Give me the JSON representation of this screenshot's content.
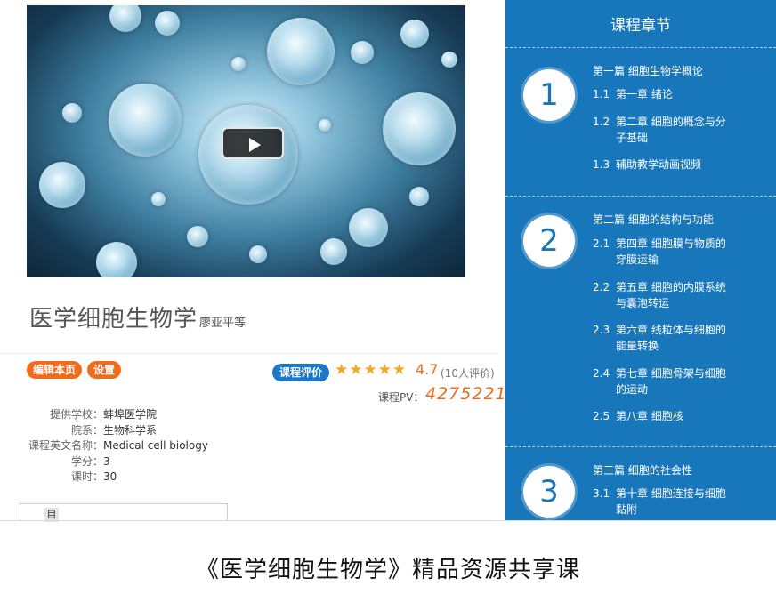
{
  "course": {
    "title": "医学细胞生物学",
    "author": "廖亚平等"
  },
  "actions": {
    "edit_label": "编辑本页",
    "settings_label": "设置",
    "rating_label": "课程评价"
  },
  "rating": {
    "stars": "★★★★★",
    "score": "4.7",
    "count_text": "(10人评价)",
    "value": 4.7,
    "max": 5
  },
  "pv": {
    "label": "课程PV：",
    "value": "4275221"
  },
  "meta": [
    {
      "key": "提供学校：",
      "value": "蚌埠医学院"
    },
    {
      "key": "院系：",
      "value": "生物科学系"
    },
    {
      "key": "课程英文名称：",
      "value": "Medical cell biology"
    },
    {
      "key": "学分：",
      "value": "3"
    },
    {
      "key": "课时：",
      "value": "30"
    }
  ],
  "tabs": {
    "first": "目"
  },
  "chapters": {
    "title": "课程章节",
    "parts": [
      {
        "number": "1",
        "title": "第一篇 细胞生物学概论",
        "items": [
          {
            "num": "1.1",
            "text": "第一章 绪论"
          },
          {
            "num": "1.2",
            "text": "第二章 细胞的概念与分子基础"
          },
          {
            "num": "1.3",
            "text": "辅助教学动画视频"
          }
        ]
      },
      {
        "number": "2",
        "title": "第二篇 细胞的结构与功能",
        "items": [
          {
            "num": "2.1",
            "text": "第四章 细胞膜与物质的穿膜运输"
          },
          {
            "num": "2.2",
            "text": "第五章 细胞的内膜系统与囊泡转运"
          },
          {
            "num": "2.3",
            "text": "第六章 线粒体与细胞的能量转换"
          },
          {
            "num": "2.4",
            "text": "第七章 细胞骨架与细胞的运动"
          },
          {
            "num": "2.5",
            "text": "第八章 细胞核"
          }
        ]
      },
      {
        "number": "3",
        "title": "第三篇 细胞的社会性",
        "items": [
          {
            "num": "3.1",
            "text": "第十章 细胞连接与细胞黏附"
          }
        ]
      }
    ]
  },
  "caption": "《医学细胞生物学》精品资源共享课",
  "colors": {
    "panel": "#1877bb",
    "accent_orange": "#f26a1a",
    "star": "#f5a623"
  }
}
